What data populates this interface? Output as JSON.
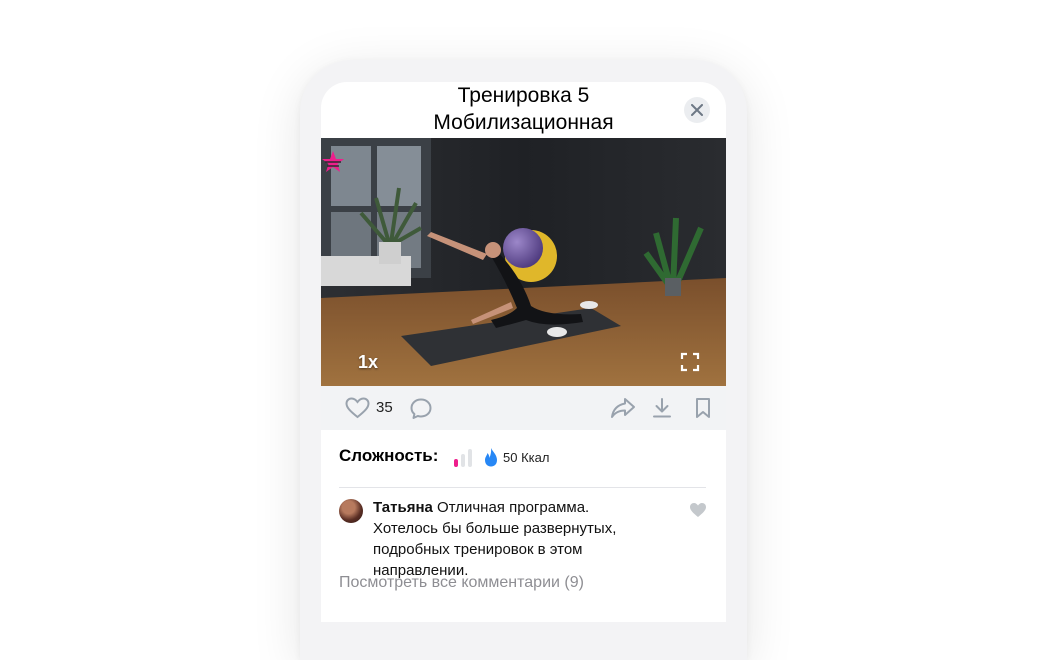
{
  "workout": {
    "title_line1": "Тренировка 5",
    "title_line2": "Мобилизационная"
  },
  "video": {
    "speed": "1x"
  },
  "actions": {
    "likes": "35"
  },
  "difficulty": {
    "label": "Сложность:",
    "level": 1,
    "max_level": 3,
    "calories": "50 Ккал"
  },
  "comment": {
    "author": "Татьяна",
    "text": "Отличная программа. Хотелось бы больше развернутых, подробных тренировок в этом направлении."
  },
  "comments_link": "Посмотреть все комментарии (9)",
  "colors": {
    "accent_pink": "#ee1e8c",
    "flame_blue": "#2787f5",
    "icon_gray": "#99a2ad",
    "action_bar_bg": "#f2f3f5"
  }
}
